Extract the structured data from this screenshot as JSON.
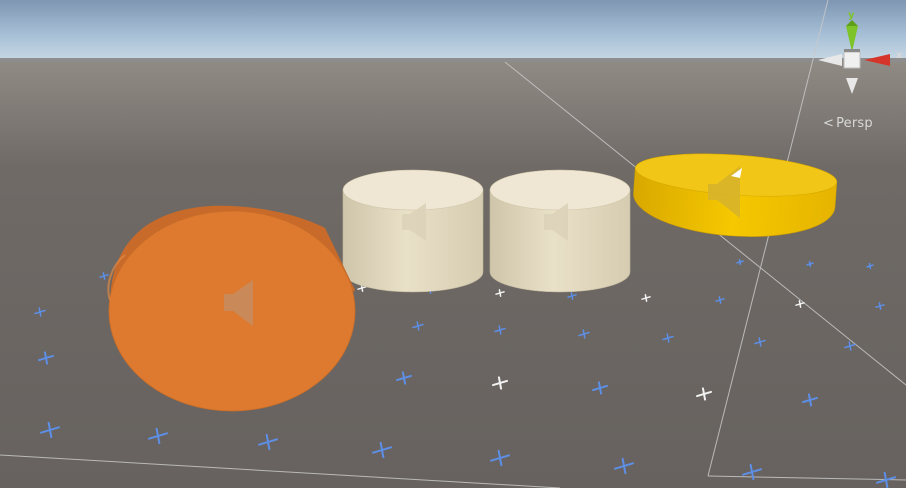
{
  "scene_view": {
    "projection_label": "Persp",
    "projection_chevron": "<",
    "gizmo": {
      "y_label": "y",
      "x_label": "x",
      "x_color": "#d6352a",
      "y_color": "#7dc32a",
      "z_color": "#4a7fd6",
      "neg_color": "#e8e8e8"
    },
    "sky_colors": [
      "#7e96b2",
      "#a6bfd6",
      "#c9d9e4"
    ],
    "ground_color": "#6b6663",
    "grid_icon_color": "#5d8fe6",
    "grid_icon_highlight": "#f2f2f2",
    "objects": [
      {
        "name": "orange-audio-cylinder",
        "color": "#e07a2e",
        "icon": "speaker-icon"
      },
      {
        "name": "cream-audio-cylinder-1",
        "color": "#e8dfc6",
        "icon": "speaker-icon"
      },
      {
        "name": "cream-audio-cylinder-2",
        "color": "#e8dfc6",
        "icon": "speaker-icon"
      },
      {
        "name": "yellow-audio-cylinder",
        "color": "#f2c200",
        "icon": "speaker-icon"
      }
    ]
  }
}
